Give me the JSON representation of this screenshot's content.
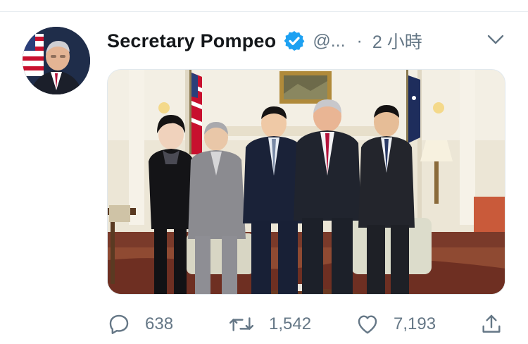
{
  "tweet": {
    "display_name": "Secretary Pompeo",
    "handle": "@...",
    "separator": "·",
    "time": "2 小時",
    "verified_icon": "verified-badge-icon",
    "verified_color": "#1da1f2",
    "menu_icon": "chevron-down-icon"
  },
  "actions": {
    "reply_count": "638",
    "retweet_count": "1,542",
    "like_count": "7,193",
    "icons": [
      "reply-icon",
      "retweet-icon",
      "like-icon",
      "share-icon"
    ]
  },
  "colors": {
    "text_primary": "#14171a",
    "text_secondary": "#657786",
    "divider": "#e6ecf0"
  }
}
